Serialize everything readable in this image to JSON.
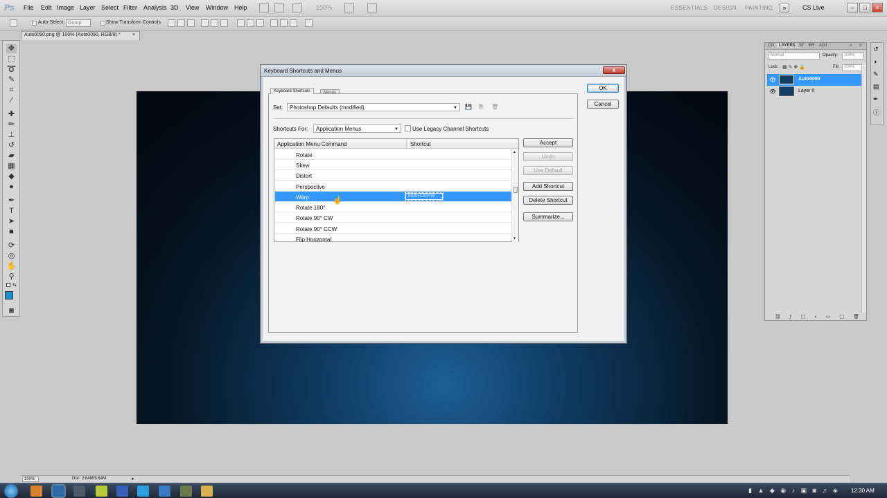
{
  "app": {
    "logo": "Ps",
    "menus": [
      "File",
      "Edit",
      "Image",
      "Layer",
      "Select",
      "Filter",
      "Analysis",
      "3D",
      "View",
      "Window",
      "Help"
    ],
    "zoom": "100%",
    "workspaces": [
      "ESSENTIALS",
      "DESIGN",
      "PAINTING"
    ],
    "cslive": "CS Live"
  },
  "options": {
    "auto_select_label": "Auto-Select:",
    "auto_select_value": "Group",
    "show_transform_label": "Show Transform Controls"
  },
  "document": {
    "tab_title": "Auto0090.png @ 100% (Auto0090, RGB/8) *",
    "status_zoom": "100%",
    "status_doc": "Doc: 2.64M/5.64M"
  },
  "panels": {
    "tabs": [
      "CO",
      "LAYERS",
      "ST",
      "BR",
      "ADJ"
    ],
    "blend_mode": "Normal",
    "opacity_label": "Opacity:",
    "opacity_value": "100%",
    "lock_label": "Lock:",
    "fill_label": "Fill:",
    "fill_value": "100%",
    "layers": [
      {
        "name": "Auto0090",
        "selected": true
      },
      {
        "name": "Layer 0",
        "selected": false
      }
    ]
  },
  "dialog": {
    "title": "Keyboard Shortcuts and Menus",
    "tabs": [
      "Keyboard Shortcuts",
      "Menus"
    ],
    "set_label": "Set:",
    "set_value": "Photoshop Defaults (modified)",
    "shortcuts_for_label": "Shortcuts For:",
    "shortcuts_for_value": "Application Menus",
    "legacy_label": "Use Legacy Channel Shortcuts",
    "col_command": "Application Menu Command",
    "col_shortcut": "Shortcut",
    "rows": [
      {
        "command": "Rotate",
        "shortcut": ""
      },
      {
        "command": "Skew",
        "shortcut": ""
      },
      {
        "command": "Distort",
        "shortcut": ""
      },
      {
        "command": "Perspective",
        "shortcut": ""
      },
      {
        "command": "Warp",
        "shortcut": "Shift+Ctrl+W"
      },
      {
        "command": "Rotate 180°",
        "shortcut": ""
      },
      {
        "command": "Rotate 90° CW",
        "shortcut": ""
      },
      {
        "command": "Rotate 90° CCW",
        "shortcut": ""
      },
      {
        "command": "Flip Horizontal",
        "shortcut": ""
      }
    ],
    "buttons": {
      "ok": "OK",
      "cancel": "Cancel",
      "accept": "Accept",
      "undo": "Undo",
      "use_default": "Use Default",
      "add_shortcut": "Add Shortcut",
      "delete_shortcut": "Delete Shortcut",
      "summarize": "Summarize..."
    },
    "close_glyph": "x"
  },
  "taskbar": {
    "clock": "12:30 AM"
  }
}
